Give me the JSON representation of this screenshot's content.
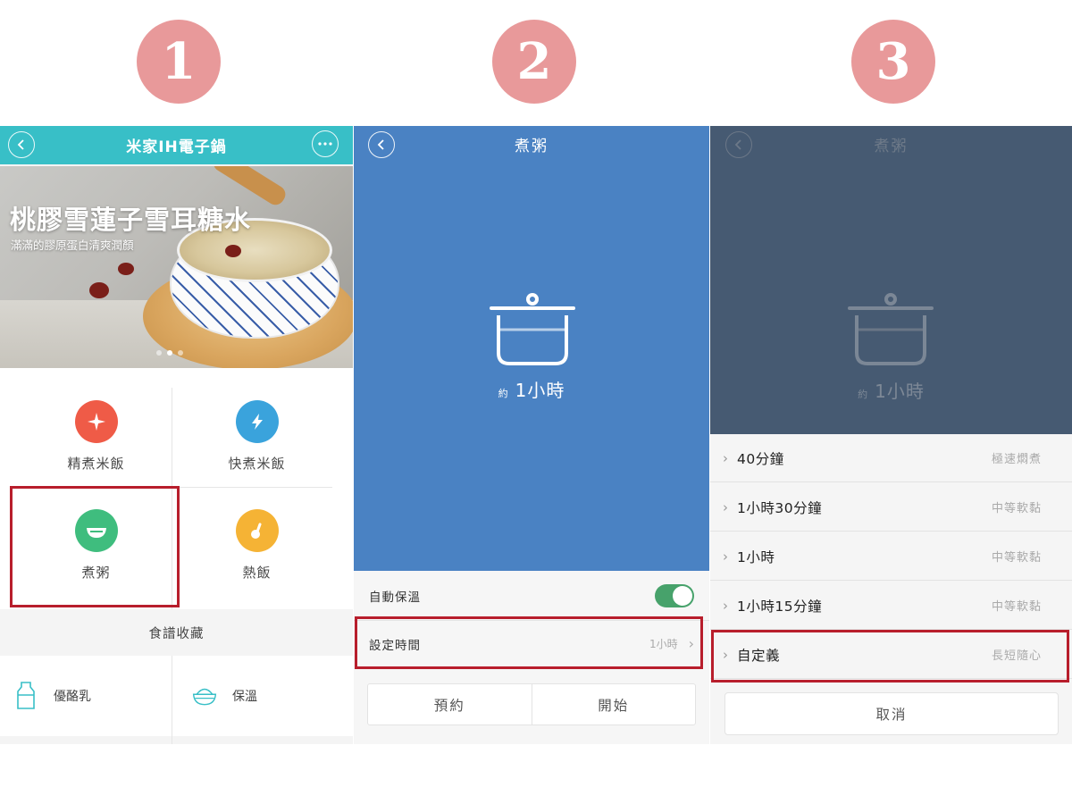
{
  "steps": [
    "1",
    "2",
    "3"
  ],
  "screen1": {
    "header": {
      "title": "米家IH電子鍋",
      "back_icon": "chevron-left-icon",
      "more_icon": "more-dots-icon"
    },
    "banner": {
      "title": "桃膠雪蓮子雪耳糖水",
      "subtitle": "滿滿的膠原蛋白清爽潤顏",
      "pages": 3,
      "active_page": 2
    },
    "modes": [
      {
        "label": "精煮米飯",
        "icon": "sparkle-icon",
        "color": "#ef5b47"
      },
      {
        "label": "快煮米飯",
        "icon": "lightning-icon",
        "color": "#3aa3dc"
      },
      {
        "label": "煮粥",
        "icon": "bowl-icon",
        "color": "#3fbd7e",
        "highlighted": true
      },
      {
        "label": "熱飯",
        "icon": "ladle-icon",
        "color": "#f5b335"
      }
    ],
    "favorites_title": "食譜收藏",
    "favorites": [
      {
        "label": "優酪乳",
        "icon": "yogurt-bottle-icon"
      },
      {
        "label": "保溫",
        "icon": "rice-bowl-icon"
      }
    ]
  },
  "screen2": {
    "title": "煮粥",
    "time_prefix": "約",
    "time_value": "1小時",
    "auto_keep_warm": {
      "label": "自動保溫",
      "enabled": true
    },
    "set_time": {
      "label": "設定時間",
      "value": "1小時"
    },
    "buttons": {
      "schedule": "預約",
      "start": "開始"
    },
    "colors": {
      "background": "#4a82c3",
      "toggle_on": "#47a26b",
      "highlight": "#b81e2c"
    }
  },
  "screen3": {
    "title": "煮粥",
    "time_prefix": "約",
    "time_value": "1小時",
    "options": [
      {
        "label": "40分鐘",
        "desc": "極速燜煮"
      },
      {
        "label": "1小時30分鐘",
        "desc": "中等軟黏"
      },
      {
        "label": "1小時",
        "desc": "中等軟黏"
      },
      {
        "label": "1小時15分鐘",
        "desc": "中等軟黏"
      },
      {
        "label": "自定義",
        "desc": "長短隨心",
        "highlighted": true
      }
    ],
    "cancel": "取消",
    "colors": {
      "background": "#465a72"
    }
  }
}
